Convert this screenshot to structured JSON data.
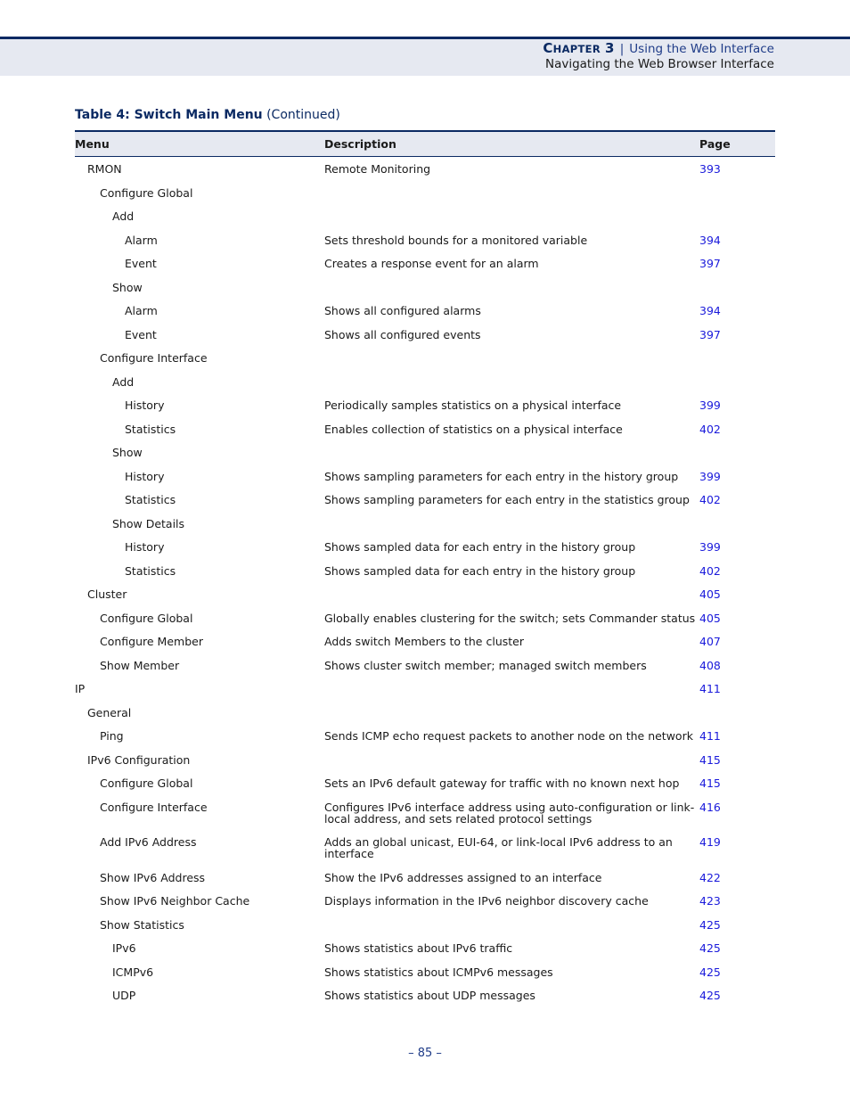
{
  "header": {
    "chapter_big": "C",
    "chapter_small": "HAPTER",
    "chapter_number": "3",
    "separator": "|",
    "chapter_title": "Using the Web Interface",
    "section_title": "Navigating the Web Browser Interface"
  },
  "caption": {
    "label": "Table 4: Switch Main Menu",
    "suffix": "(Continued)"
  },
  "table": {
    "headers": [
      "Menu",
      "Description",
      "Page"
    ],
    "rows": [
      {
        "menu": "RMON",
        "level": 1,
        "description": "Remote Monitoring",
        "page": "393"
      },
      {
        "menu": "Configure Global",
        "level": 2,
        "description": "",
        "page": ""
      },
      {
        "menu": "Add",
        "level": 3,
        "description": "",
        "page": ""
      },
      {
        "menu": "Alarm",
        "level": 4,
        "description": "Sets threshold bounds for a monitored variable",
        "page": "394"
      },
      {
        "menu": "Event",
        "level": 4,
        "description": "Creates a response event for an alarm",
        "page": "397"
      },
      {
        "menu": "Show",
        "level": 3,
        "description": "",
        "page": ""
      },
      {
        "menu": "Alarm",
        "level": 4,
        "description": "Shows all configured alarms",
        "page": "394"
      },
      {
        "menu": "Event",
        "level": 4,
        "description": "Shows all configured events",
        "page": "397"
      },
      {
        "menu": "Configure Interface",
        "level": 2,
        "description": "",
        "page": ""
      },
      {
        "menu": "Add",
        "level": 3,
        "description": "",
        "page": ""
      },
      {
        "menu": "History",
        "level": 4,
        "description": "Periodically samples statistics on a physical interface",
        "page": "399"
      },
      {
        "menu": "Statistics",
        "level": 4,
        "description": "Enables collection of statistics on a physical interface",
        "page": "402"
      },
      {
        "menu": "Show",
        "level": 3,
        "description": "",
        "page": ""
      },
      {
        "menu": "History",
        "level": 4,
        "description": "Shows sampling parameters for each entry in the history group",
        "page": "399"
      },
      {
        "menu": "Statistics",
        "level": 4,
        "description": "Shows sampling parameters for each entry in the statistics group",
        "page": "402"
      },
      {
        "menu": "Show Details",
        "level": 3,
        "description": "",
        "page": ""
      },
      {
        "menu": "History",
        "level": 4,
        "description": "Shows sampled data for each entry in the history group",
        "page": "399"
      },
      {
        "menu": "Statistics",
        "level": 4,
        "description": "Shows sampled data for each entry in the history group",
        "page": "402"
      },
      {
        "menu": "Cluster",
        "level": 1,
        "description": "",
        "page": "405"
      },
      {
        "menu": "Configure Global",
        "level": 2,
        "description": "Globally enables clustering for the switch; sets Commander status",
        "page": "405"
      },
      {
        "menu": "Configure Member",
        "level": 2,
        "description": "Adds switch Members to the cluster",
        "page": "407"
      },
      {
        "menu": "Show Member",
        "level": 2,
        "description": "Shows cluster switch member; managed switch members",
        "page": "408"
      },
      {
        "menu": "IP",
        "level": 0,
        "description": "",
        "page": "411"
      },
      {
        "menu": "General",
        "level": 1,
        "description": "",
        "page": ""
      },
      {
        "menu": "Ping",
        "level": 2,
        "description": "Sends ICMP echo request packets to another node on the network",
        "page": "411"
      },
      {
        "menu": "IPv6 Configuration",
        "level": 1,
        "description": "",
        "page": "415"
      },
      {
        "menu": "Configure Global",
        "level": 2,
        "description": "Sets an IPv6 default gateway for traffic with no known next hop",
        "page": "415"
      },
      {
        "menu": "Configure Interface",
        "level": 2,
        "description": "Configures IPv6 interface address using auto-configuration or link-local address, and sets related protocol settings",
        "page": "416"
      },
      {
        "menu": "Add IPv6 Address",
        "level": 2,
        "description": "Adds an global unicast, EUI-64, or link-local IPv6 address to an interface",
        "page": "419"
      },
      {
        "menu": "Show IPv6 Address",
        "level": 2,
        "description": "Show the IPv6 addresses assigned to an interface",
        "page": "422"
      },
      {
        "menu": "Show IPv6 Neighbor Cache",
        "level": 2,
        "description": "Displays information in the IPv6 neighbor discovery cache",
        "page": "423"
      },
      {
        "menu": "Show Statistics",
        "level": 2,
        "description": "",
        "page": "425"
      },
      {
        "menu": "IPv6",
        "level": 3,
        "description": "Shows statistics about IPv6 traffic",
        "page": "425"
      },
      {
        "menu": "ICMPv6",
        "level": 3,
        "description": "Shows statistics about ICMPv6 messages",
        "page": "425"
      },
      {
        "menu": "UDP",
        "level": 3,
        "description": "Shows statistics about UDP messages",
        "page": "425"
      }
    ]
  },
  "footer": {
    "page_number": "–  85  –"
  }
}
